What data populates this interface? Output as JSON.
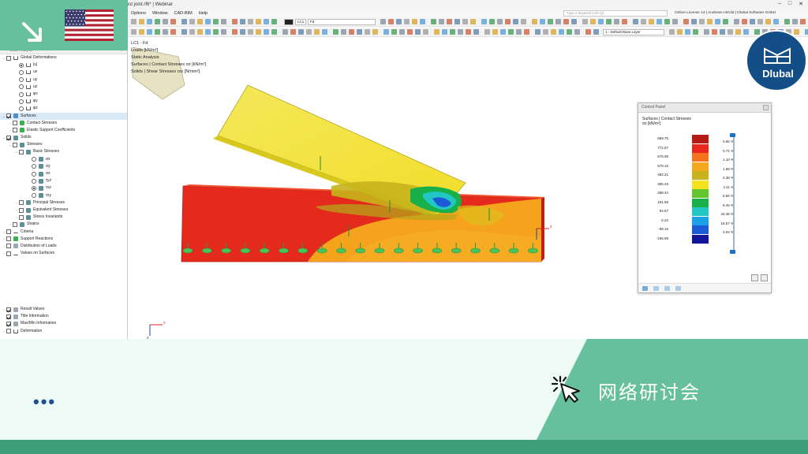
{
  "window": {
    "title": "ust joint.rf6* | Webinar",
    "controls": [
      "–",
      "□",
      "✕"
    ]
  },
  "menubar": {
    "items": [
      "Options",
      "Window",
      "CAD-BIM",
      "Help"
    ],
    "search_placeholder": "Type a keyword (Alt+Q)",
    "license": "Online License 13 | Andreas Hörold | Dlubal Software GmbH"
  },
  "toolbar": {
    "loadcase_code": "LC1",
    "loadcase_name": "Fd",
    "base_layer": "1 - Default Base Layer"
  },
  "navigator": {
    "header": "Static Analysis",
    "items": [
      {
        "label": "Global Deformations",
        "indent": 0,
        "arrow": "v",
        "mark": "cb",
        "checked": false,
        "icon": "def"
      },
      {
        "label": "|u|",
        "indent": 2,
        "mark": "rb",
        "checked": true,
        "icon": "def"
      },
      {
        "label": "ux",
        "indent": 2,
        "mark": "rb",
        "checked": false,
        "icon": "def"
      },
      {
        "label": "uy",
        "indent": 2,
        "mark": "rb",
        "checked": false,
        "icon": "def"
      },
      {
        "label": "uz",
        "indent": 2,
        "mark": "rb",
        "checked": false,
        "icon": "def"
      },
      {
        "label": "φx",
        "indent": 2,
        "mark": "rb",
        "checked": false,
        "icon": "def"
      },
      {
        "label": "φy",
        "indent": 2,
        "mark": "rb",
        "checked": false,
        "icon": "def"
      },
      {
        "label": "φz",
        "indent": 2,
        "mark": "rb",
        "checked": false,
        "icon": "def"
      },
      {
        "label": "Surfaces",
        "indent": 0,
        "arrow": "v",
        "mark": "cb",
        "checked": true,
        "icon": "surf",
        "selected": true
      },
      {
        "label": "Contact Stresses",
        "indent": 1,
        "arrow": ">",
        "mark": "cb",
        "checked": false,
        "icon": "green"
      },
      {
        "label": "Elastic Support Coefficients",
        "indent": 1,
        "arrow": ">",
        "mark": "cb",
        "checked": false,
        "icon": "green"
      },
      {
        "label": "Solids",
        "indent": 0,
        "arrow": "v",
        "mark": "cb",
        "checked": true,
        "icon": "solid"
      },
      {
        "label": "Stresses",
        "indent": 1,
        "arrow": "v",
        "mark": "cb",
        "checked": false,
        "icon": "solid"
      },
      {
        "label": "Basic Stresses",
        "indent": 2,
        "arrow": "v",
        "mark": "cb",
        "checked": false,
        "icon": "solid"
      },
      {
        "label": "σx",
        "indent": 4,
        "mark": "rb",
        "checked": false,
        "icon": "solid"
      },
      {
        "label": "σy",
        "indent": 4,
        "mark": "rb",
        "checked": false,
        "icon": "solid"
      },
      {
        "label": "σz",
        "indent": 4,
        "mark": "rb",
        "checked": false,
        "icon": "solid"
      },
      {
        "label": "τyz",
        "indent": 4,
        "mark": "rb",
        "checked": false,
        "icon": "solid"
      },
      {
        "label": "τxz",
        "indent": 4,
        "mark": "rb",
        "checked": true,
        "icon": "solid"
      },
      {
        "label": "τxy",
        "indent": 4,
        "mark": "rb",
        "checked": false,
        "icon": "solid"
      },
      {
        "label": "Principal Stresses",
        "indent": 2,
        "arrow": ">",
        "mark": "cb",
        "checked": false,
        "icon": "solid"
      },
      {
        "label": "Equivalent Stresses",
        "indent": 2,
        "arrow": ">",
        "mark": "cb",
        "checked": false,
        "icon": "solid"
      },
      {
        "label": "Stress Invariants",
        "indent": 2,
        "arrow": ">",
        "mark": "cb",
        "checked": false,
        "icon": "solid"
      },
      {
        "label": "Strains",
        "indent": 1,
        "arrow": ">",
        "mark": "cb",
        "checked": false,
        "icon": "solid"
      },
      {
        "label": "Criteria",
        "indent": 0,
        "arrow": ">",
        "mark": "cb",
        "checked": false,
        "icon": "line"
      },
      {
        "label": "Support Reactions",
        "indent": 0,
        "arrow": ">",
        "mark": "cb",
        "checked": false,
        "icon": "green"
      },
      {
        "label": "Distribution of Loads",
        "indent": 0,
        "arrow": ">",
        "mark": "cb",
        "checked": false,
        "icon": "gray"
      },
      {
        "label": "Values on Surfaces",
        "indent": 0,
        "arrow": ">",
        "mark": "cb",
        "checked": false,
        "icon": "line"
      }
    ],
    "lower_items": [
      {
        "label": "Result Values",
        "arrow": ">",
        "mark": "cb",
        "checked": true,
        "icon": "gray"
      },
      {
        "label": "Title Information",
        "arrow": "",
        "mark": "cb",
        "checked": true,
        "icon": "gray"
      },
      {
        "label": "Max/Min Information",
        "arrow": "",
        "mark": "cb",
        "checked": true,
        "icon": "gray"
      },
      {
        "label": "Deformation",
        "arrow": ">",
        "mark": "cb",
        "checked": false,
        "icon": "def"
      }
    ]
  },
  "viewport_info": {
    "line1": "LC1 - Fd",
    "line2": "Loads [kN/m²]",
    "line3": "Static Analysis",
    "line4": "Surfaces | Contact Stresses σz [kN/m²]",
    "line5": "Solids | Shear Stresses τxz [N/mm²]"
  },
  "control_panel": {
    "title": "Control Panel",
    "subtitle1": "Surfaces | Contact Stresses",
    "subtitle2": "σz [kN/m²]",
    "scale": [
      {
        "value": "869.76",
        "color": "#b61a14",
        "percent": "0.66 %"
      },
      {
        "value": "772.87",
        "color": "#e8271c",
        "percent": "0.71 %"
      },
      {
        "value": "675.98",
        "color": "#f4731c",
        "percent": "1.10 %"
      },
      {
        "value": "579.10",
        "color": "#f3a81e",
        "percent": "1.68 %"
      },
      {
        "value": "482.21",
        "color": "#c7b41c",
        "percent": "2.38 %"
      },
      {
        "value": "385.33",
        "color": "#f4e21c",
        "percent": "4.11 %"
      },
      {
        "value": "288.44",
        "color": "#62c62c",
        "percent": "6.56 %"
      },
      {
        "value": "191.56",
        "color": "#18b04a",
        "percent": "9.45 %"
      },
      {
        "value": "94.67",
        "color": "#22c7c4",
        "percent": "34.38 %"
      },
      {
        "value": "-2.22",
        "color": "#1aa0e6",
        "percent": "16.57 %"
      },
      {
        "value": "-99.10",
        "color": "#1c5bd6",
        "percent": "3.04 %"
      },
      {
        "value": "-195.99",
        "color": "#141499",
        "percent": ""
      }
    ]
  },
  "overlay": {
    "brand": "Dlubal",
    "webinar_label": "网络研讨会",
    "ellipsis": "•••",
    "colors": {
      "green": "#66bf9d",
      "navy": "#134e86",
      "mint_band": "#eefaf6"
    }
  },
  "axes": {
    "x": "x",
    "z": "z"
  }
}
